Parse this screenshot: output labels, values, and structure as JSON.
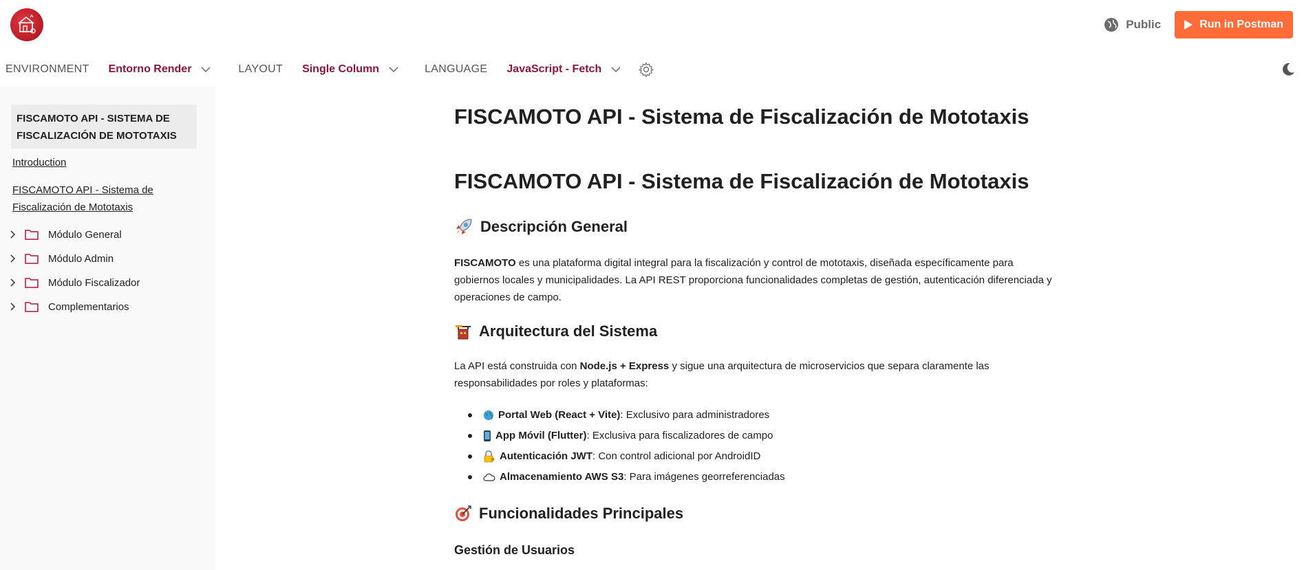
{
  "header": {
    "logo_icon": "fiscamoto-logo",
    "visibility_label": "Public",
    "run_button_label": "Run in Postman",
    "run_button_color": "#ff6c37"
  },
  "nav": {
    "environment_label": "ENVIRONMENT",
    "environment_value": "Entorno Render",
    "layout_label": "LAYOUT",
    "layout_value": "Single Column",
    "language_label": "LANGUAGE",
    "language_value": "JavaScript - Fetch",
    "accent_color": "#8e1537"
  },
  "sidebar": {
    "active_title": "FISCAMOTO API - SISTEMA DE FISCALIZACIÓN DE MOTOTAXIS",
    "links": [
      "Introduction",
      "FISCAMOTO API - Sistema de Fiscalización de Mototaxis"
    ],
    "folders": [
      "Módulo General",
      "Módulo Admin",
      "Módulo Fiscalizador",
      "Complementarios"
    ]
  },
  "content": {
    "title": "FISCAMOTO API - Sistema de Fiscalización de Mototaxis",
    "title_repeat": "FISCAMOTO API - Sistema de Fiscalización de Mototaxis",
    "section1_title": "Descripción General",
    "section1_bold": "FISCAMOTO",
    "section1_text": " es una plataforma digital integral para la fiscalización y control de mototaxis, diseñada específicamente para gobiernos locales y municipalidades. La API REST proporciona funcionalidades completas de gestión, autenticación diferenciada y operaciones de campo.",
    "section2_title": "Arquitectura del Sistema",
    "section2_text_a": "La API está construida con ",
    "section2_bold": "Node.js + Express",
    "section2_text_b": " y sigue una arquitectura de microservicios que separa claramente las responsabilidades por roles y plataformas:",
    "features": [
      {
        "icon": "globe-icon",
        "bold": "Portal Web (React + Vite)",
        "text": ": Exclusivo para administradores"
      },
      {
        "icon": "mobile-phone-icon",
        "bold": "App Móvil (Flutter)",
        "text": ": Exclusiva para fiscalizadores de campo"
      },
      {
        "icon": "lock-key-icon",
        "bold": "Autenticación JWT",
        "text": ": Con control adicional por AndroidID"
      },
      {
        "icon": "cloud-icon",
        "bold": "Almacenamiento AWS S3",
        "text": ": Para imágenes georreferenciadas"
      }
    ],
    "section3_title": "Funcionalidades Principales",
    "subsection_title": "Gestión de Usuarios"
  }
}
